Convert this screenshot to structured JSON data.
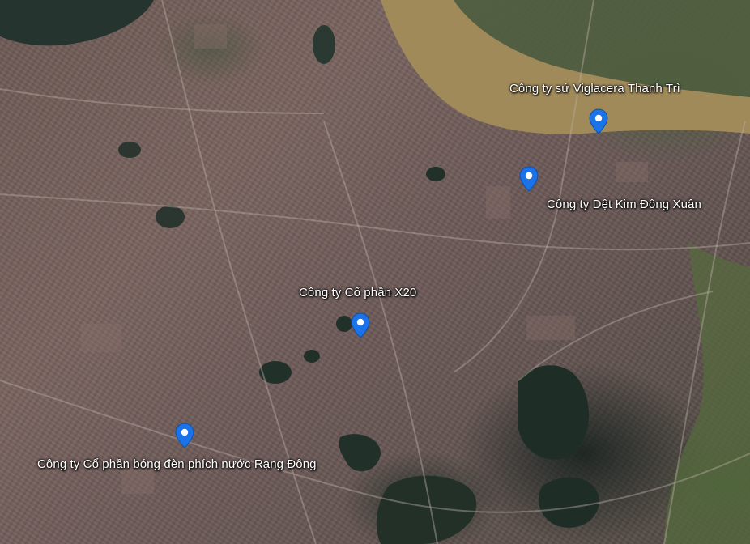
{
  "map": {
    "type": "satellite",
    "colors": {
      "river": "#a08a5a",
      "water": "#223028",
      "urban": "#745f5a",
      "pin": "#1a73e8",
      "label": "#ffffff"
    },
    "markers": [
      {
        "label": "Công ty sứ Viglacera Thanh Trì",
        "icon": "map-pin-icon"
      },
      {
        "label": "Công ty Dệt Kim Đông Xuân",
        "icon": "map-pin-icon"
      },
      {
        "label": "Công ty Cổ phần X20",
        "icon": "map-pin-icon"
      },
      {
        "label": "Công ty Cổ phần bóng đèn phích nước Rạng Đông",
        "icon": "map-pin-icon"
      }
    ]
  }
}
